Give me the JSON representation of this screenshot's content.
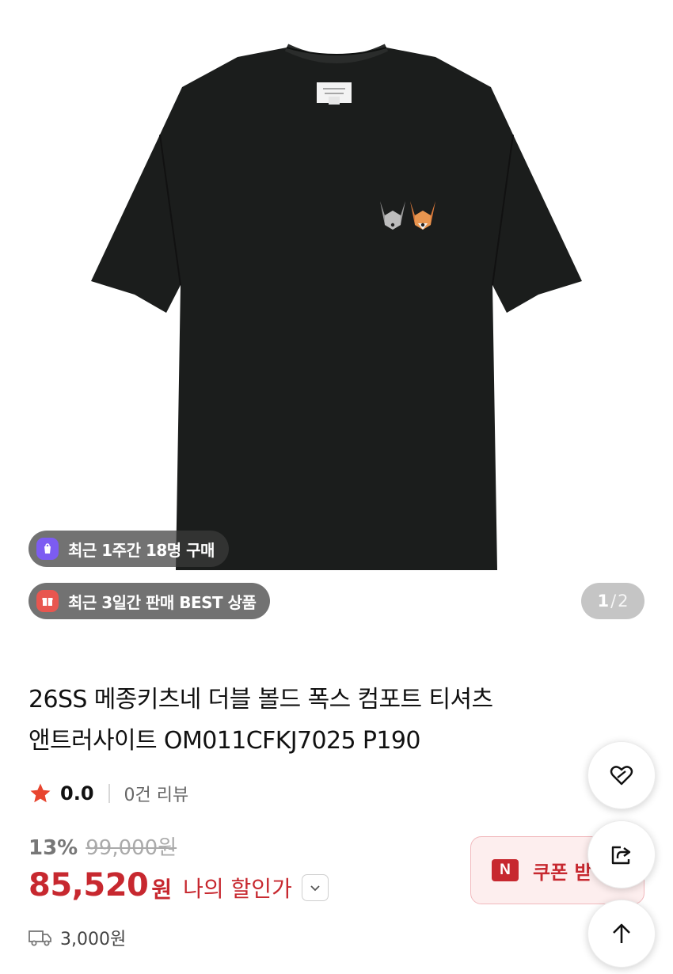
{
  "product_image": {
    "counter_current": "1",
    "counter_separator": "/",
    "counter_total": "2"
  },
  "badges": [
    {
      "icon": "shopping-bag-icon",
      "icon_color": "#7c5cf2",
      "text": "최근 1주간 18명 구매"
    },
    {
      "icon": "gift-icon",
      "icon_color": "#e8564f",
      "text": "최근 3일간 판매 BEST 상품"
    }
  ],
  "product": {
    "title_line1": "26SS 메종키츠네 더블 볼드 폭스 컴포트 티셔츠",
    "title_line2": "앤트러사이트 OM011CFKJ7025 P190",
    "rating_score": "0.0",
    "review_count_text": "0건 리뷰",
    "discount_rate": "13%",
    "original_price": "99,000원",
    "sale_price": "85,520",
    "sale_price_unit": "원",
    "my_discount_label": "나의 할인가",
    "shipping_fee": "3,000원"
  },
  "coupon": {
    "logo_text": "N",
    "label": "쿠폰 받"
  },
  "colors": {
    "accent": "#c7282f",
    "star": "#e8452f",
    "badge_bg": "#3c3c3c",
    "shirt": "#1b1d1c"
  },
  "fab_icons": [
    "heart-link-icon",
    "share-icon",
    "arrow-up-icon"
  ]
}
